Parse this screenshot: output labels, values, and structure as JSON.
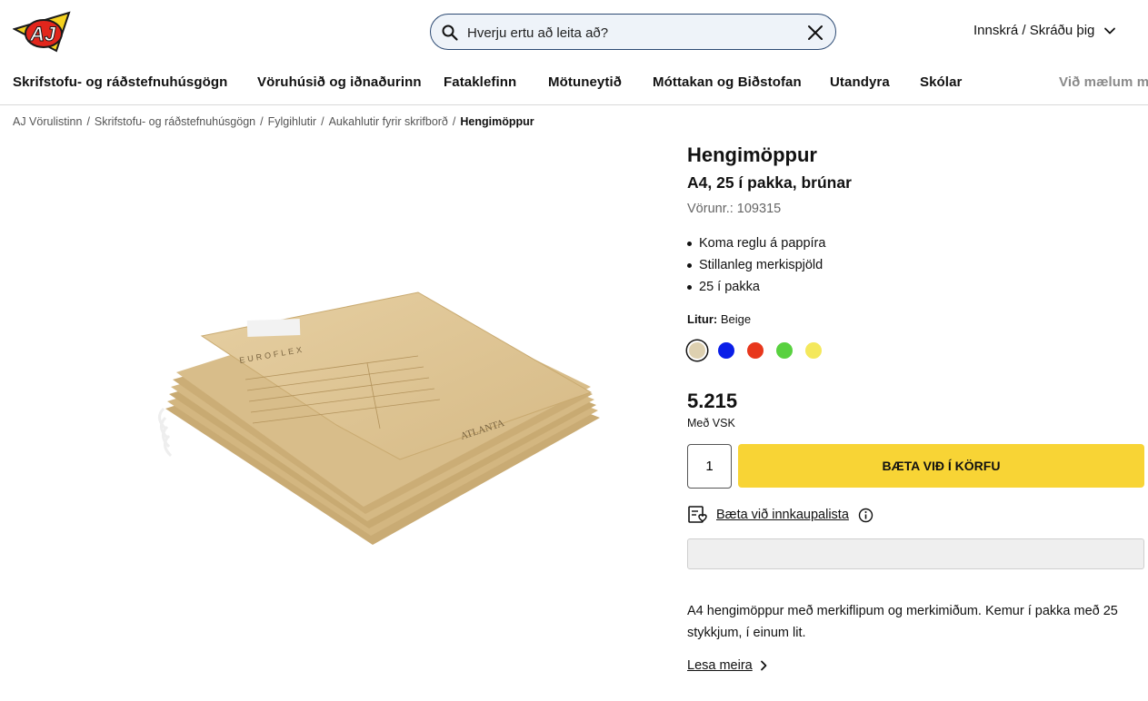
{
  "header": {
    "search_placeholder": "Hverju ertu að leita að?",
    "account_label": "Innskrá / Skráðu þig"
  },
  "nav": {
    "items": [
      "Skrifstofu- og ráðstefnuhúsgögn",
      "Vöruhúsið og iðnaðurinn",
      "Fataklefinn",
      "Mötuneytið",
      "Móttakan og Biðstofan",
      "Utandyra",
      "Skólar",
      "Við mælum m"
    ]
  },
  "breadcrumb": {
    "items": [
      "AJ Vörulistinn",
      "Skrifstofu- og ráðstefnuhúsgögn",
      "Fylgihlutir",
      "Aukahlutir fyrir skrifborð"
    ],
    "current": "Hengimöppur",
    "separator": "/"
  },
  "product": {
    "title": "Hengimöppur",
    "subtitle": "A4, 25 í pakka, brúnar",
    "sku_label": "Vörunr.: 109315",
    "features": [
      "Koma reglu á pappíra",
      "Stillanleg merkispjöld",
      "25 í pakka"
    ],
    "color_label": "Litur:",
    "color_value": "Beige",
    "swatches": [
      {
        "name": "beige",
        "color": "#ddd0b0",
        "selected": true
      },
      {
        "name": "blue",
        "color": "#0a1ee8",
        "selected": false
      },
      {
        "name": "red",
        "color": "#e8371c",
        "selected": false
      },
      {
        "name": "green",
        "color": "#58d13f",
        "selected": false
      },
      {
        "name": "yellow",
        "color": "#f4e85c",
        "selected": false
      }
    ],
    "price": "5.215",
    "vat_label": "Með VSK",
    "quantity": "1",
    "add_to_cart": "BÆTA VIÐ Í KÖRFU",
    "wishlist_label": "Bæta við innkaupalista",
    "description": "A4 hengimöppur með merkiflipum og merkimiðum. Kemur í pakka með 25 stykkjum, í einum lit.",
    "read_more": "Lesa meira",
    "image_text": {
      "brand": "EUROFLEX",
      "model": "ATLANTA"
    }
  },
  "colors": {
    "accent_yellow": "#f8d435",
    "search_border": "#2c4a73",
    "search_bg": "#eef3f9"
  }
}
